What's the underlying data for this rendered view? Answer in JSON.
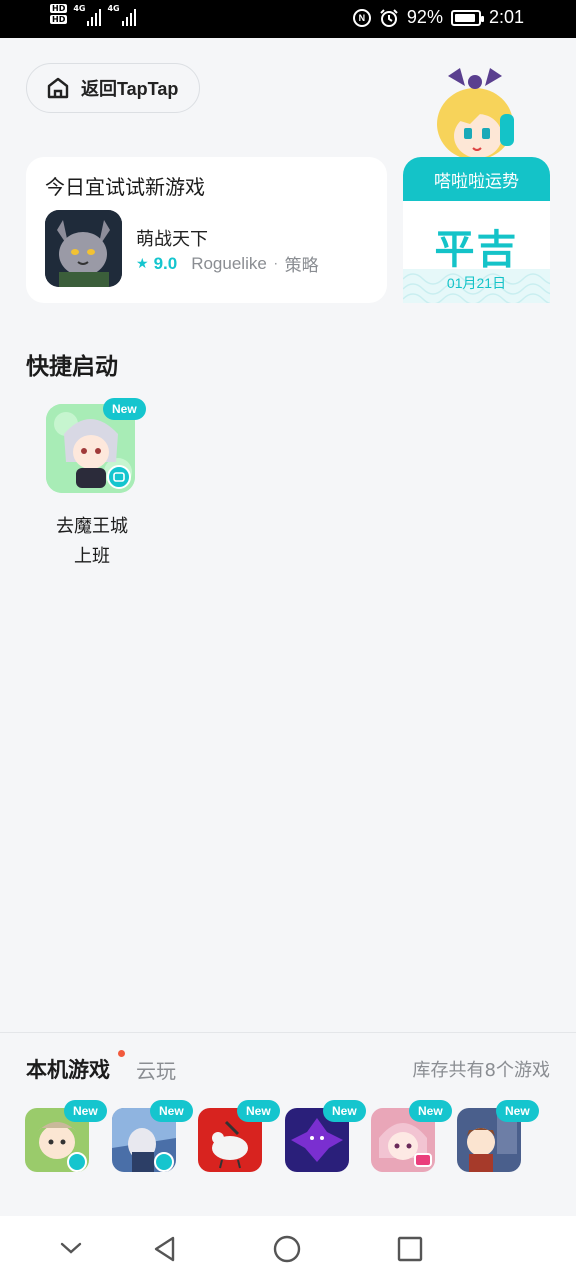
{
  "status_bar": {
    "hd_labels": [
      "HD",
      "HD"
    ],
    "network_labels": [
      "4G",
      "4G"
    ],
    "icons": [
      "nfc-icon",
      "alarm-icon",
      "battery-icon"
    ],
    "battery": "92%",
    "time": "2:01"
  },
  "header": {
    "back_label": "返回TapTap",
    "back_icon": "home-icon"
  },
  "today_card": {
    "title": "今日宜试试新游戏",
    "game": {
      "name": "萌战天下",
      "rating": "9.0",
      "tags": [
        "Roguelike",
        "策略"
      ]
    }
  },
  "fortune": {
    "header": "嗒啦啦运势",
    "value": "平吉",
    "date": "01月21日"
  },
  "quick_launch": {
    "title": "快捷启动",
    "items": [
      {
        "badge": "New",
        "label_line1": "去魔王城",
        "label_line2": "上班"
      }
    ]
  },
  "library": {
    "tab_local": "本机游戏",
    "tab_cloud": "云玩",
    "count_text": "库存共有8个游戏",
    "games": [
      {
        "badge": "New",
        "color": "#9acb6b"
      },
      {
        "badge": "New",
        "color": "#4a6fa8"
      },
      {
        "badge": "New",
        "color": "#d8231f"
      },
      {
        "badge": "New",
        "color": "#2a1f7a"
      },
      {
        "badge": "New",
        "color": "#e9a6b8"
      },
      {
        "badge": "New",
        "color": "#7c5a4a"
      }
    ]
  },
  "colors": {
    "accent": "#15c5ce",
    "background": "#f5f6f8",
    "notification_dot": "#f25a3d"
  },
  "nav_bar": {
    "icons": [
      "chevron-down-icon",
      "back-triangle-icon",
      "home-circle-icon",
      "recents-square-icon"
    ]
  }
}
